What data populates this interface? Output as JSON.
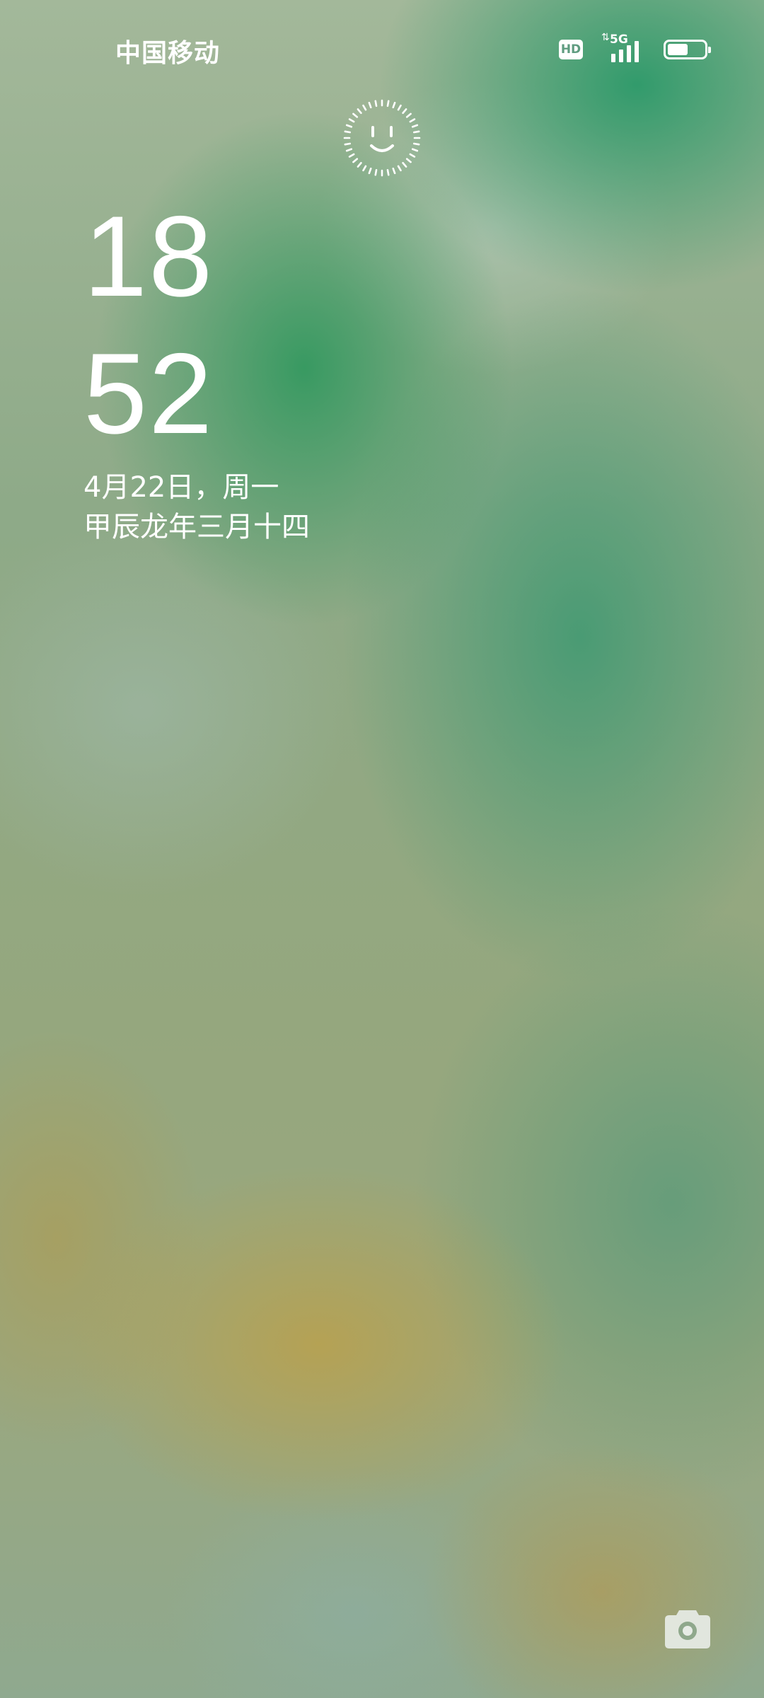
{
  "status_bar": {
    "carrier": "中国移动",
    "hd_badge": "HD",
    "network_type": "5G",
    "signal_bars_filled": 4,
    "battery_level": 0.55
  },
  "lock_screen": {
    "face_unlock_icon": "face-unlock-icon",
    "clock": {
      "hours": "18",
      "minutes": "52"
    },
    "date": "4月22日，周一",
    "lunar_date": "甲辰龙年三月十四"
  },
  "shortcuts": {
    "camera_icon": "camera-icon"
  },
  "colors": {
    "text": "#ffffff",
    "wallpaper_green": "#2e9a64",
    "wallpaper_ochre": "#b8a054"
  }
}
